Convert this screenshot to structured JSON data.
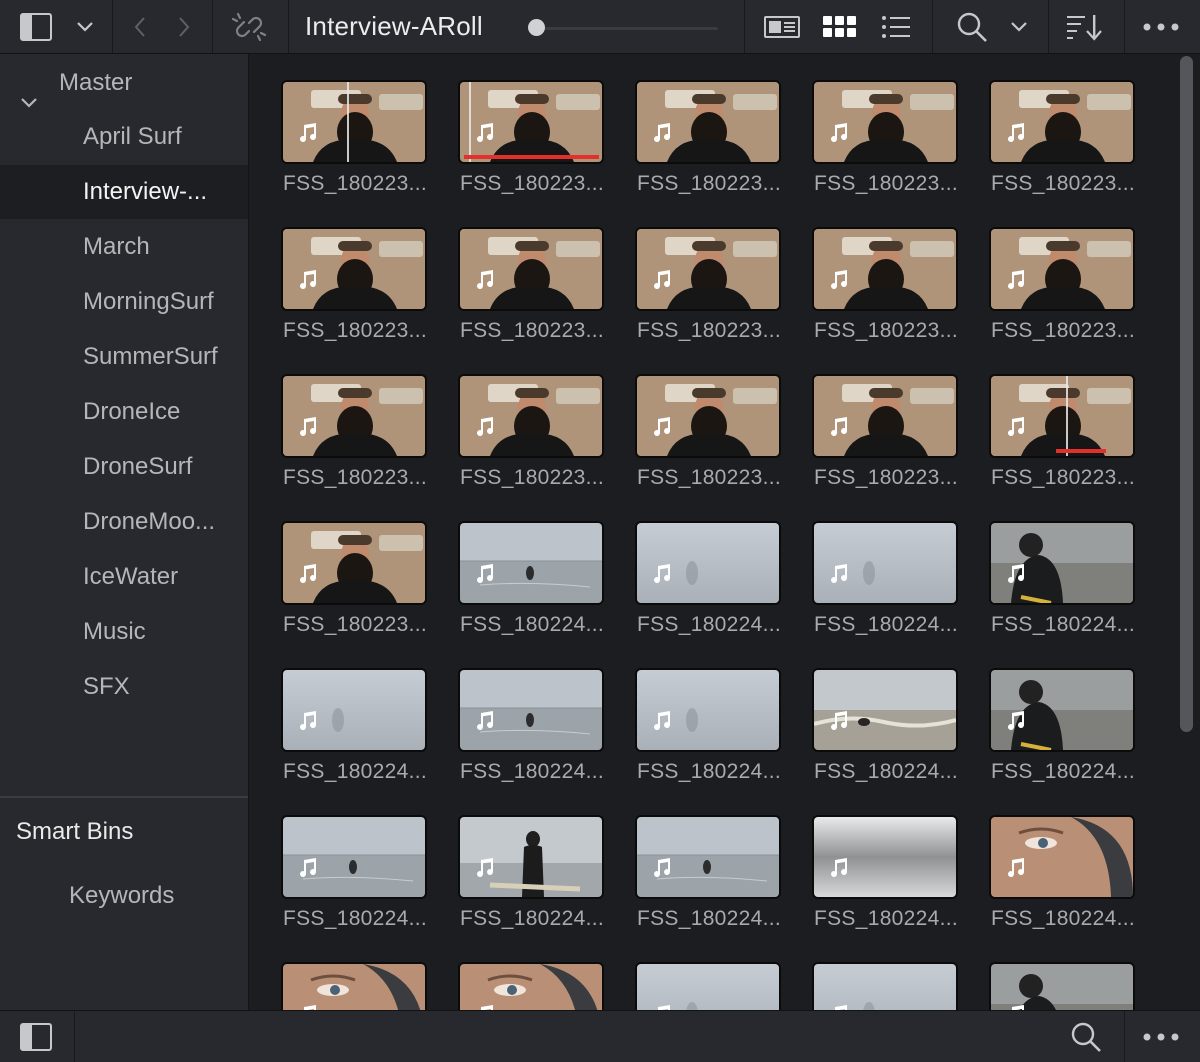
{
  "toolbar": {
    "bin_title": "Interview-ARoll",
    "icons": [
      "sidebar-toggle-icon",
      "chevron-down-icon",
      "back-arrow-icon",
      "forward-arrow-icon",
      "unlink-icon",
      "metadata-view-icon",
      "thumbnail-view-icon",
      "list-view-icon",
      "search-icon",
      "chevron-down-icon",
      "sort-icon",
      "more-options-icon"
    ],
    "active_view": "thumbnail-view"
  },
  "sidebar": {
    "master_label": "Master",
    "bins": [
      {
        "label": "April Surf"
      },
      {
        "label": "Interview-..."
      },
      {
        "label": "March"
      },
      {
        "label": "MorningSurf"
      },
      {
        "label": "SummerSurf"
      },
      {
        "label": "DroneIce"
      },
      {
        "label": "DroneSurf"
      },
      {
        "label": "DroneMoo..."
      },
      {
        "label": "IceWater"
      },
      {
        "label": "Music"
      },
      {
        "label": "SFX"
      }
    ],
    "selected_bin": "Interview-...",
    "smart_bins_label": "Smart Bins",
    "keywords_label": "Keywords"
  },
  "clips": [
    {
      "name": "FSS_180223...",
      "scene": "interview",
      "playhead_pct": 45
    },
    {
      "name": "FSS_180223...",
      "scene": "interview",
      "playhead_pct": 6,
      "progress_pct": 95
    },
    {
      "name": "FSS_180223...",
      "scene": "interview"
    },
    {
      "name": "FSS_180223...",
      "scene": "interview"
    },
    {
      "name": "FSS_180223...",
      "scene": "interview"
    },
    {
      "name": "FSS_180223...",
      "scene": "interview"
    },
    {
      "name": "FSS_180223...",
      "scene": "interview"
    },
    {
      "name": "FSS_180223...",
      "scene": "interview"
    },
    {
      "name": "FSS_180223...",
      "scene": "interview"
    },
    {
      "name": "FSS_180223...",
      "scene": "interview"
    },
    {
      "name": "FSS_180223...",
      "scene": "interview"
    },
    {
      "name": "FSS_180223...",
      "scene": "interview"
    },
    {
      "name": "FSS_180223...",
      "scene": "interview"
    },
    {
      "name": "FSS_180223...",
      "scene": "interview"
    },
    {
      "name": "FSS_180223...",
      "scene": "interview",
      "playhead_pct": 53,
      "progress_pct": 50
    },
    {
      "name": "FSS_180223...",
      "scene": "interview"
    },
    {
      "name": "FSS_180224...",
      "scene": "water-far"
    },
    {
      "name": "FSS_180224...",
      "scene": "fog"
    },
    {
      "name": "FSS_180224...",
      "scene": "fog"
    },
    {
      "name": "FSS_180224...",
      "scene": "surfer-near"
    },
    {
      "name": "FSS_180224...",
      "scene": "fog"
    },
    {
      "name": "FSS_180224...",
      "scene": "water-far"
    },
    {
      "name": "FSS_180224...",
      "scene": "fog"
    },
    {
      "name": "FSS_180224...",
      "scene": "waves"
    },
    {
      "name": "FSS_180224...",
      "scene": "surfer-near"
    },
    {
      "name": "FSS_180224...",
      "scene": "water-far"
    },
    {
      "name": "FSS_180224...",
      "scene": "surfer-standing"
    },
    {
      "name": "FSS_180224...",
      "scene": "water-far"
    },
    {
      "name": "FSS_180224...",
      "scene": "blur"
    },
    {
      "name": "FSS_180224...",
      "scene": "closeup"
    },
    {
      "name": "",
      "scene": "closeup"
    },
    {
      "name": "",
      "scene": "closeup"
    },
    {
      "name": "",
      "scene": "fog"
    },
    {
      "name": "",
      "scene": "fog"
    },
    {
      "name": "",
      "scene": "surfer-near"
    }
  ],
  "bottombar": {
    "icons": [
      "sidebar-toggle-icon",
      "search-icon",
      "more-options-icon"
    ]
  }
}
